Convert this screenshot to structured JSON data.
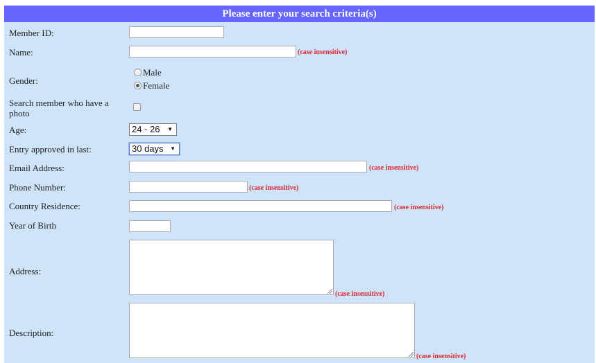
{
  "form": {
    "title": "Please enter your search criteria(s)",
    "note_text": "(case insensitive)",
    "member_id": {
      "label": "Member ID:",
      "value": ""
    },
    "name": {
      "label": "Name:",
      "value": ""
    },
    "gender": {
      "label": "Gender:",
      "options": [
        {
          "label": "Male",
          "selected": false
        },
        {
          "label": "Female",
          "selected": true
        }
      ]
    },
    "photo": {
      "label": "Search member who have a photo",
      "checked": false
    },
    "age": {
      "label": "Age:",
      "selected": "24 - 26"
    },
    "entry_approved": {
      "label": "Entry approved in last:",
      "selected": "30 days"
    },
    "email": {
      "label": "Email Address:",
      "value": ""
    },
    "phone": {
      "label": "Phone Number:",
      "value": ""
    },
    "country": {
      "label": "Country Residence:",
      "value": ""
    },
    "year_of_birth": {
      "label": "Year of Birth",
      "value": ""
    },
    "address": {
      "label": "Address:",
      "value": ""
    },
    "description": {
      "label": "Description:",
      "value": ""
    }
  },
  "icons": {
    "select_arrow": "chevron-down-icon",
    "textarea_grip": "resize-grip-icon"
  },
  "colors": {
    "header_bg": "#6666ff",
    "panel_bg": "#cfe4fb",
    "note_red": "#e0242b"
  }
}
